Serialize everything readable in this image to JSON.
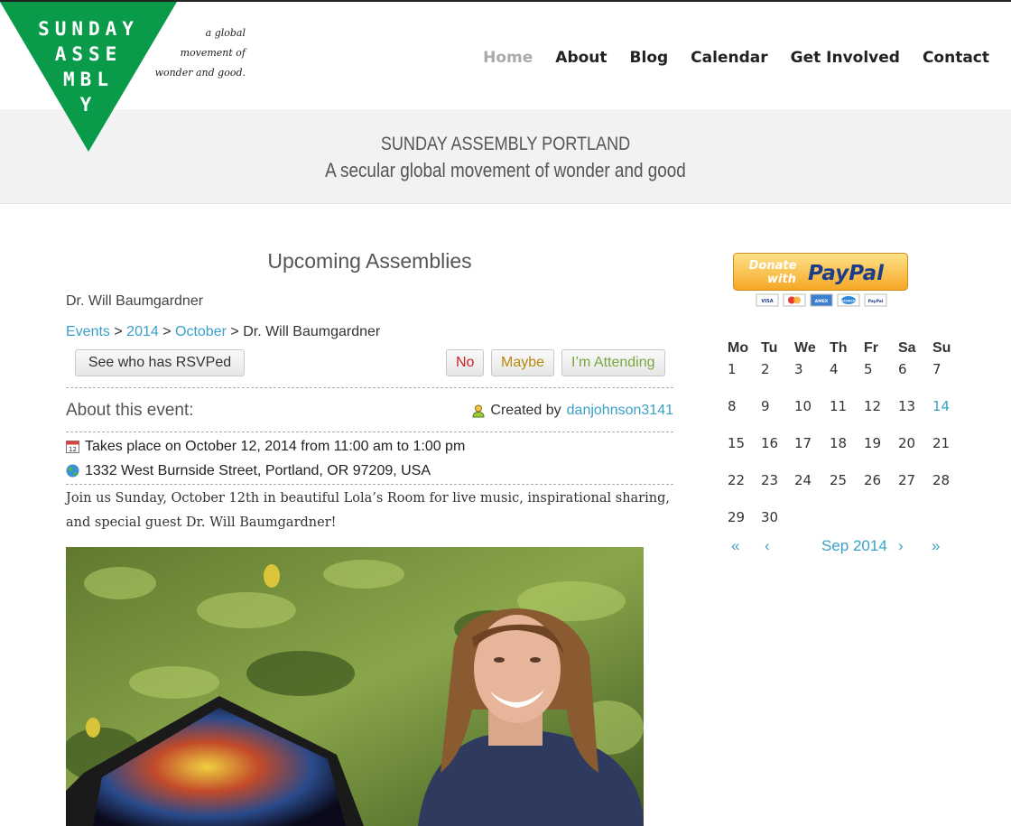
{
  "logo": {
    "letters": [
      "SUNDAY",
      "ASSE",
      "MBL",
      "Y"
    ],
    "tagline": [
      "a global",
      "movement of",
      "wonder and good."
    ],
    "color": "#0a9b4a"
  },
  "nav": {
    "items": [
      {
        "label": "Home",
        "active": true
      },
      {
        "label": "About"
      },
      {
        "label": "Blog"
      },
      {
        "label": "Calendar"
      },
      {
        "label": "Get Involved"
      },
      {
        "label": "Contact"
      }
    ]
  },
  "banner": {
    "title": "SUNDAY ASSEMBLY PORTLAND",
    "subtitle": "A secular global movement of wonder and good"
  },
  "main": {
    "section_title": "Upcoming Assemblies",
    "event_name": "Dr. Will Baumgardner",
    "breadcrumb": {
      "events": "Events",
      "year": "2014",
      "month": "October",
      "sep": ">",
      "current": "Dr. Will Baumgardner"
    },
    "rsvp": {
      "who_label": "See who has RSVPed",
      "no_label": "No",
      "maybe_label": "Maybe",
      "attending_label": "I’m Attending"
    },
    "about_title": "About this event:",
    "created_by_label": "Created by",
    "created_by_user": "danjohnson3141",
    "time_text": "Takes place on October 12, 2014 from 11:00 am to 1:00 pm",
    "address_text": "1332 West Burnside Street, Portland, OR 97209, USA",
    "description": "Join us Sunday, October 12th in beautiful Lola’s Room for live music, inspirational sharing, and special guest Dr. Will Baumgardner!"
  },
  "sidebar": {
    "paypal": {
      "line1": "Donate",
      "line2": "with",
      "brand": "PayPal",
      "cards": [
        "VISA",
        "MC",
        "AMEX",
        "ECHECK",
        "PayPal"
      ]
    },
    "calendar": {
      "weekdays": [
        "Mo",
        "Tu",
        "We",
        "Th",
        "Fr",
        "Sa",
        "Su"
      ],
      "weeks": [
        [
          "1",
          "2",
          "3",
          "4",
          "5",
          "6",
          "7"
        ],
        [
          "8",
          "9",
          "10",
          "11",
          "12",
          "13",
          "14"
        ],
        [
          "15",
          "16",
          "17",
          "18",
          "19",
          "20",
          "21"
        ],
        [
          "22",
          "23",
          "24",
          "25",
          "26",
          "27",
          "28"
        ],
        [
          "29",
          "30",
          "",
          "",
          "",
          "",
          ""
        ]
      ],
      "today": "14",
      "month_label": "Sep 2014",
      "prev_year": "«",
      "prev_month": "‹",
      "next_month": "›",
      "next_year": "»"
    }
  },
  "colors": {
    "link": "#3aa0c8",
    "brand_green": "#0a9b4a",
    "banner_bg": "#f2f2f2"
  }
}
